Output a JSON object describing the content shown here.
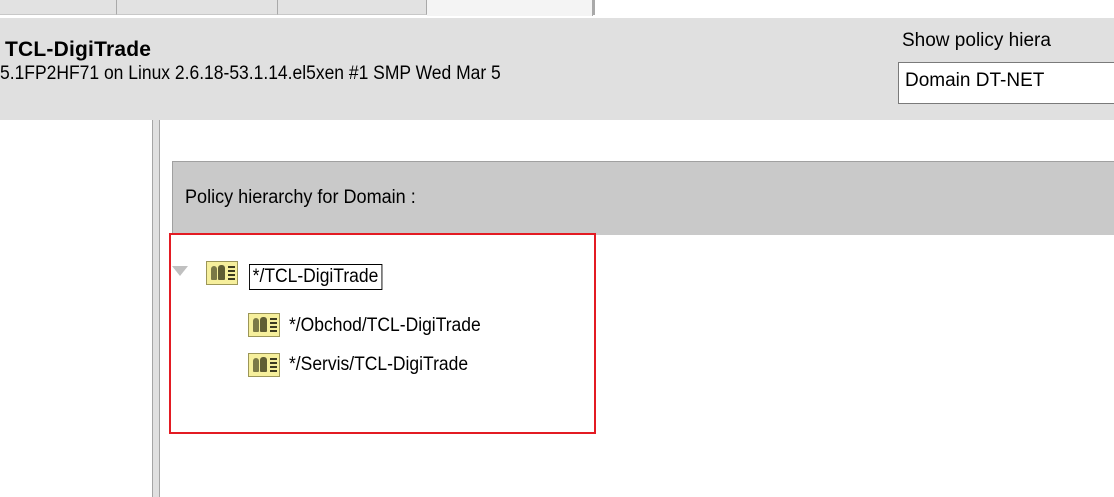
{
  "header": {
    "server_name": "TCL-DigiTrade",
    "server_info": "5.1FP2HF71 on Linux 2.6.18-53.1.14.el5xen #1 SMP Wed Mar 5",
    "show_policy_label": "Show policy hiera",
    "domain_select_value": "Domain DT-NET"
  },
  "policy_panel": {
    "header_label": "Policy hierarchy for Domain :"
  },
  "tree": {
    "root": {
      "label": "*/TCL-DigiTrade",
      "icon": "policy-group-icon",
      "expanded": true,
      "selected": true
    },
    "children": [
      {
        "label": "*/Obchod/TCL-DigiTrade",
        "icon": "policy-group-icon"
      },
      {
        "label": "*/Servis/TCL-DigiTrade",
        "icon": "policy-group-icon"
      }
    ]
  },
  "colors": {
    "header_bg": "#e0e0e0",
    "panel_header_bg": "#c9c9c9",
    "highlight": "#e31b23",
    "icon_bg": "#f6ef9c"
  }
}
